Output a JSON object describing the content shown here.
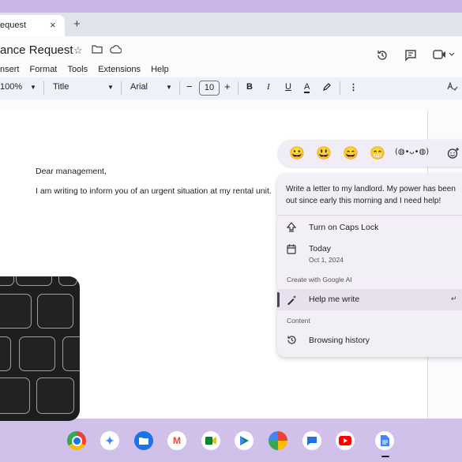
{
  "tab": {
    "title": "equest",
    "close": "×",
    "new_tab": "+"
  },
  "doc": {
    "title": "ance Request",
    "menu": [
      "nsert",
      "Format",
      "Tools",
      "Extensions",
      "Help"
    ]
  },
  "toolbar": {
    "zoom": "100%",
    "style": "Title",
    "font": "Arial",
    "minus": "−",
    "font_size": "10",
    "plus": "+",
    "bold": "B",
    "italic": "I",
    "underline": "U",
    "text_color": "A",
    "more": "⋮"
  },
  "document": {
    "line1": "Dear management,",
    "line2": "I am writing to inform you of an urgent situation at my rental unit."
  },
  "emoji_bar": {
    "emojis": [
      "😀",
      "😃",
      "😄",
      "😁"
    ],
    "kaomoji": "(◍•ᴗ•◍)"
  },
  "assist": {
    "prompt": "Write a letter to my landlord. My power has been out since early this morning and I need help!",
    "caps_lock": "Turn on Caps Lock",
    "today_label": "Today",
    "today_date": "Oct 1, 2024",
    "section_ai": "Create with Google AI",
    "help_me_write": "Help me write",
    "enter_hint": "↵",
    "section_content": "Content",
    "browsing_history": "Browsing history"
  },
  "shelf": {
    "apps": [
      "chrome-icon",
      "gemini-icon",
      "files-icon",
      "gmail-icon",
      "meet-icon",
      "play-store-icon",
      "photos-icon",
      "chat-icon",
      "youtube-icon",
      "docs-icon"
    ]
  },
  "colors": {
    "accent": "#0b57d0",
    "panel_bg": "#f3eff7"
  }
}
